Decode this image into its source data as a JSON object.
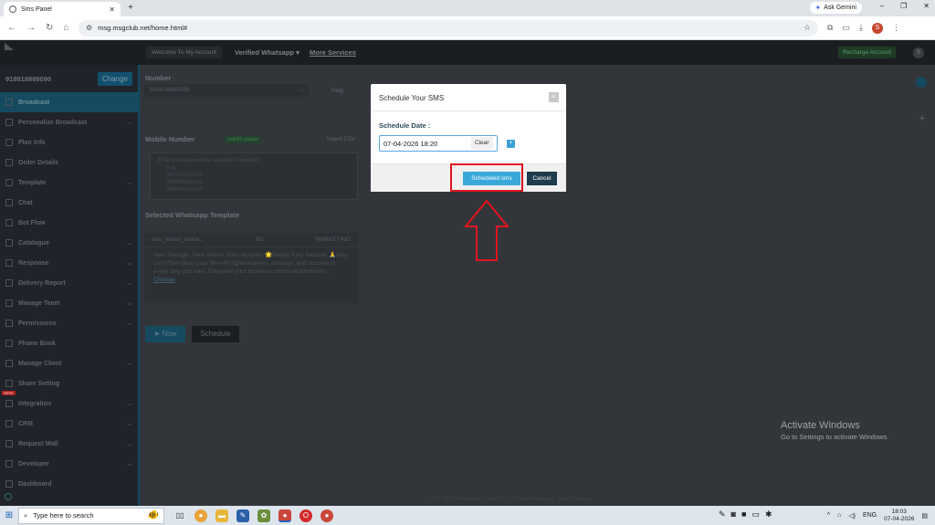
{
  "browser": {
    "tab_title": "Sms Panel",
    "url": "msg.msgclub.net/home.html#",
    "gemini_label": "Ask Gemini",
    "profile_initial": "S"
  },
  "topnav": {
    "welcome": "Welcome To My Account",
    "verified": "Verified Whatsapp ▾",
    "more_services": "More Services",
    "recharge": "Recharge Account",
    "user_initial": "S"
  },
  "sidebar": {
    "phone": "918818889090",
    "change_label": "Change",
    "items": [
      {
        "label": "Broadcast",
        "chevron": false
      },
      {
        "label": "Personalize Broadcast",
        "chevron": true
      },
      {
        "label": "Plan Info",
        "chevron": false
      },
      {
        "label": "Order Details",
        "chevron": false
      },
      {
        "label": "Template",
        "chevron": true
      },
      {
        "label": "Chat",
        "chevron": false
      },
      {
        "label": "Bot Flow",
        "chevron": false
      },
      {
        "label": "Catalogue",
        "chevron": true
      },
      {
        "label": "Response",
        "chevron": true
      },
      {
        "label": "Delivery Report",
        "chevron": true
      },
      {
        "label": "Manage Team",
        "chevron": true
      },
      {
        "label": "Permissions",
        "chevron": true
      },
      {
        "label": "Phone Book",
        "chevron": false
      },
      {
        "label": "Manage Client",
        "chevron": true
      },
      {
        "label": "Share Setting",
        "chevron": false
      },
      {
        "label": "Integration",
        "chevron": true
      },
      {
        "label": "CRM",
        "chevron": true
      },
      {
        "label": "Request Wall",
        "chevron": true
      },
      {
        "label": "Developer",
        "chevron": true
      },
      {
        "label": "Dashboard",
        "chevron": false
      }
    ],
    "new_badge": "NEW"
  },
  "form": {
    "number_label": "Number",
    "number_value": "918818889090",
    "help": "Help",
    "mobile_label": "Mobile Number",
    "mobile_badge": "Valid(0) groups",
    "import_csv": "Import CSV",
    "mobile_placeholder_lines": [
      "Enter comma/newline separated numbers",
      "e.g.",
      "9XXXXXXXXX",
      "9XXXXXXXXX",
      "9XXXXXXXXX"
    ],
    "template_label": "Selected Whatsapp Template",
    "template_name": "ram_navmi_wishe...",
    "template_lang": "En",
    "template_category": "MARKETING",
    "template_body": "New Strength, New Values, New Victories 🌟Happy Ram Navami! 🙏May Lord Ram bless your life with righteousness, courage, and success in every step you take. Empower your business communication with ...",
    "template_change": "Change",
    "now_label": "Now",
    "schedule_label": "Schedule"
  },
  "modal": {
    "title": "Schedule Your SMS",
    "close": "×",
    "date_label": "Schedule Date :",
    "date_value": "07-04-2026 18:20",
    "clear": "Clear",
    "plus": "+",
    "scheduled_btn": "Scheduled sms",
    "cancel_btn": "Cancel"
  },
  "rail": {
    "plus": "+"
  },
  "footer": {
    "copyright": "© 2026 · All Rights Reserved · Sms Panel · All Rights Reserved · Rights Reserved"
  },
  "windows": {
    "activate_title": "Activate Windows",
    "activate_sub": "Go to Settings to activate Windows."
  },
  "taskbar": {
    "search_placeholder": "Type here to search",
    "lang": "ENG",
    "time": "18:03",
    "date": "07-04-2026"
  },
  "colors": {
    "accent": "#3aa9d9",
    "highlight": "#e1141d",
    "sidebar_active": "#164a60"
  }
}
